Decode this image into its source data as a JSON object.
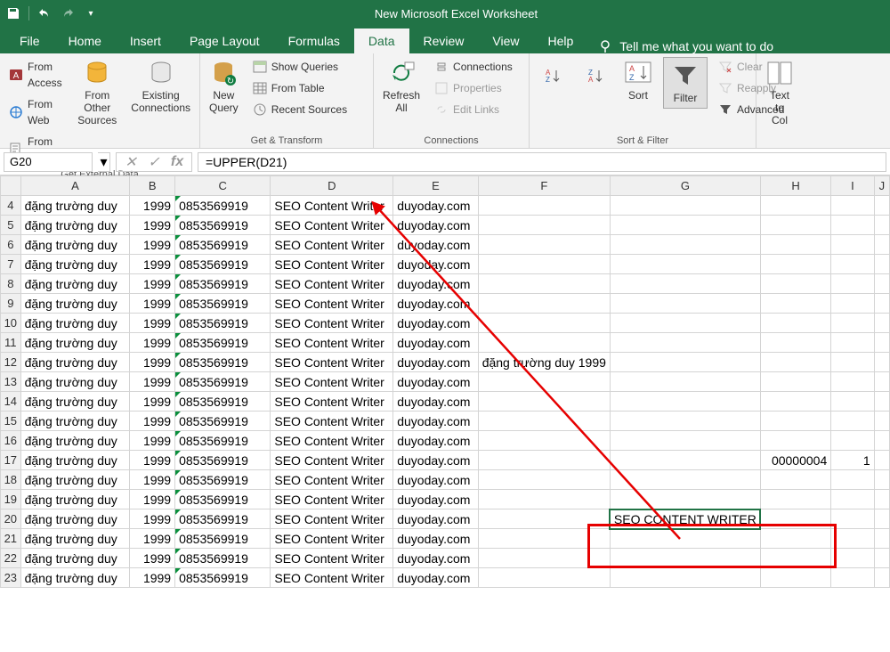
{
  "title": "New Microsoft Excel Worksheet",
  "tabs": [
    "File",
    "Home",
    "Insert",
    "Page Layout",
    "Formulas",
    "Data",
    "Review",
    "View",
    "Help"
  ],
  "active_tab": "Data",
  "tell_me": "Tell me what you want to do",
  "ribbon": {
    "ext": {
      "label": "Get External Data",
      "access": "From Access",
      "web": "From Web",
      "text": "From Text",
      "other": "From Other\nSources",
      "existing": "Existing\nConnections"
    },
    "gt": {
      "label": "Get & Transform",
      "new": "New\nQuery",
      "show": "Show Queries",
      "table": "From Table",
      "recent": "Recent Sources"
    },
    "conn": {
      "label": "Connections",
      "refresh": "Refresh\nAll",
      "conns": "Connections",
      "props": "Properties",
      "edit": "Edit Links"
    },
    "sf": {
      "label": "Sort & Filter",
      "sort": "Sort",
      "filter": "Filter",
      "clear": "Clear",
      "reapply": "Reapply",
      "adv": "Advanced"
    },
    "dt": {
      "text": "Text to\nCol"
    }
  },
  "namebox": "G20",
  "formula": "=UPPER(D21)",
  "cols": [
    "A",
    "B",
    "C",
    "D",
    "E",
    "F",
    "G",
    "H",
    "I",
    "J"
  ],
  "rows": [
    {
      "n": 4,
      "a": "đặng trường duy",
      "b": "1999",
      "c": "0853569919",
      "d": "SEO Content Writer",
      "e": "duyoday.com"
    },
    {
      "n": 5,
      "a": "đặng trường duy",
      "b": "1999",
      "c": "0853569919",
      "d": "SEO Content Writer",
      "e": "duyoday.com"
    },
    {
      "n": 6,
      "a": "đặng trường duy",
      "b": "1999",
      "c": "0853569919",
      "d": "SEO Content Writer",
      "e": "duyoday.com"
    },
    {
      "n": 7,
      "a": "đặng trường duy",
      "b": "1999",
      "c": "0853569919",
      "d": "SEO Content Writer",
      "e": "duyoday.com"
    },
    {
      "n": 8,
      "a": "đặng trường duy",
      "b": "1999",
      "c": "0853569919",
      "d": "SEO Content Writer",
      "e": "duyoday.com"
    },
    {
      "n": 9,
      "a": "đặng trường duy",
      "b": "1999",
      "c": "0853569919",
      "d": "SEO Content Writer",
      "e": "duyoday.com"
    },
    {
      "n": 10,
      "a": "đặng trường duy",
      "b": "1999",
      "c": "0853569919",
      "d": "SEO Content Writer",
      "e": "duyoday.com"
    },
    {
      "n": 11,
      "a": "đặng trường duy",
      "b": "1999",
      "c": "0853569919",
      "d": "SEO Content Writer",
      "e": "duyoday.com"
    },
    {
      "n": 12,
      "a": "đặng trường duy",
      "b": "1999",
      "c": "0853569919",
      "d": "SEO Content Writer",
      "e": "duyoday.com",
      "f": "đặng trường duy 1999"
    },
    {
      "n": 13,
      "a": "đặng trường duy",
      "b": "1999",
      "c": "0853569919",
      "d": "SEO Content Writer",
      "e": "duyoday.com"
    },
    {
      "n": 14,
      "a": "đặng trường duy",
      "b": "1999",
      "c": "0853569919",
      "d": "SEO Content Writer",
      "e": "duyoday.com"
    },
    {
      "n": 15,
      "a": "đặng trường duy",
      "b": "1999",
      "c": "0853569919",
      "d": "SEO Content Writer",
      "e": "duyoday.com"
    },
    {
      "n": 16,
      "a": "đặng trường duy",
      "b": "1999",
      "c": "0853569919",
      "d": "SEO Content Writer",
      "e": "duyoday.com"
    },
    {
      "n": 17,
      "a": "đặng trường duy",
      "b": "1999",
      "c": "0853569919",
      "d": "SEO Content Writer",
      "e": "duyoday.com",
      "h": "00000004",
      "i": "1"
    },
    {
      "n": 18,
      "a": "đặng trường duy",
      "b": "1999",
      "c": "0853569919",
      "d": "SEO Content Writer",
      "e": "duyoday.com"
    },
    {
      "n": 19,
      "a": "đặng trường duy",
      "b": "1999",
      "c": "0853569919",
      "d": "SEO Content Writer",
      "e": "duyoday.com"
    },
    {
      "n": 20,
      "a": "đặng trường duy",
      "b": "1999",
      "c": "0853569919",
      "d": "SEO Content Writer",
      "e": "duyoday.com",
      "g": "SEO CONTENT WRITER"
    },
    {
      "n": 21,
      "a": "đặng trường duy",
      "b": "1999",
      "c": "0853569919",
      "d": "SEO Content Writer",
      "e": "duyoday.com"
    },
    {
      "n": 22,
      "a": "đặng trường duy",
      "b": "1999",
      "c": "0853569919",
      "d": "SEO Content Writer",
      "e": "duyoday.com"
    },
    {
      "n": 23,
      "a": "đặng trường duy",
      "b": "1999",
      "c": "0853569919",
      "d": "SEO Content Writer",
      "e": "duyoday.com"
    }
  ]
}
